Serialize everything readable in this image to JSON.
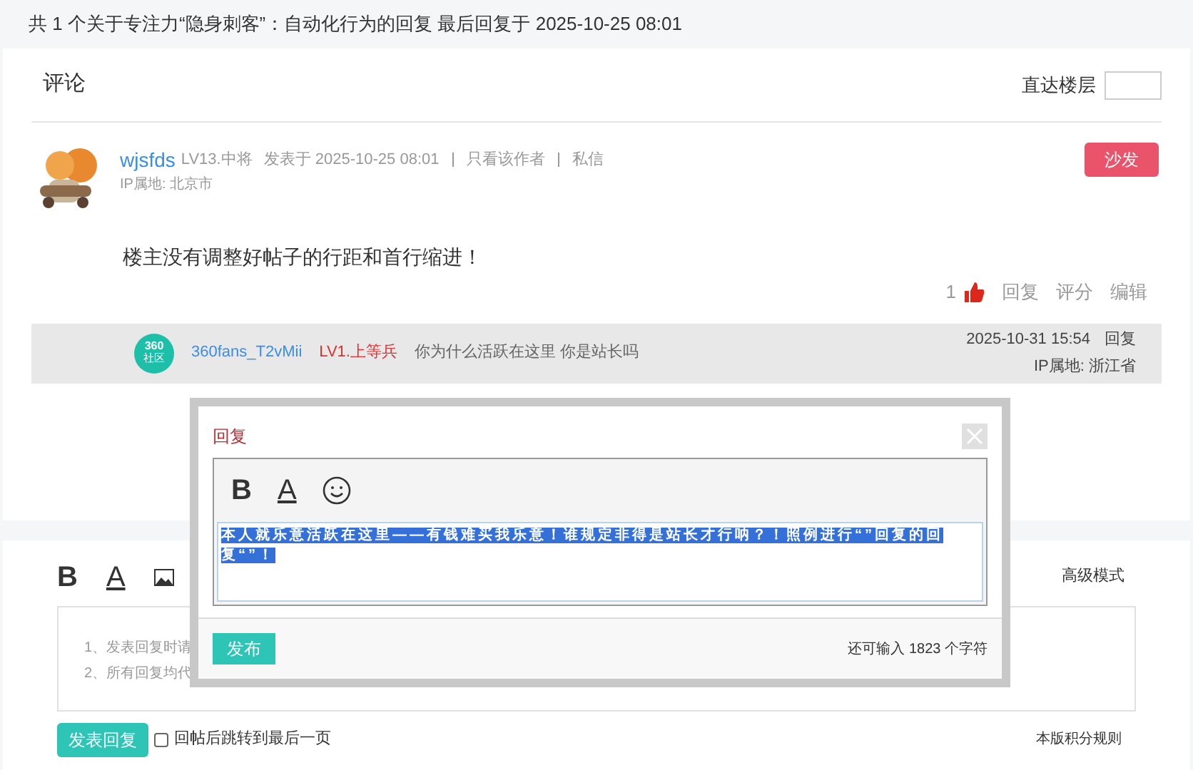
{
  "summary": "共 1 个关于专注力“隐身刺客”：自动化行为的回复 最后回复于 2025-10-25 08:01",
  "section_title": "评论",
  "jump": {
    "label": "直达楼层"
  },
  "post": {
    "author": "wjsfds",
    "level": "LV13.中将",
    "posted": "发表于 2025-10-25 08:01",
    "links": [
      "只看该作者",
      "私信"
    ],
    "ip": "IP属地: 北京市",
    "badge": "沙发",
    "body": "楼主没有调整好帖子的行距和首行缩进！",
    "likes": "1",
    "actions": [
      "回复",
      "评分",
      "编辑"
    ]
  },
  "sub_reply": {
    "logo_text": [
      "360",
      "社区"
    ],
    "author": "360fans_T2vMii",
    "level": "LV1.上等兵",
    "text": "你为什么活跃在这里 你是站长吗",
    "time": "2025-10-31 15:54",
    "reply": "回复",
    "ip": "IP属地: 浙江省"
  },
  "editor": {
    "tools": [
      "B",
      "A"
    ],
    "advanced": "高级模式",
    "hints": [
      "1、发表回复时请",
      "2、所有回复均代"
    ],
    "submit": "发表回复",
    "jump_last": {
      "label": "回帖后跳转到最后一页",
      "checked": false
    },
    "rules": "本版积分规则"
  },
  "dialog": {
    "title": "回复",
    "tools": [
      "B",
      "A"
    ],
    "text": "本人就乐意活跃在这里——有钱难买我乐意！谁规定非得是站长才行呐？！照例进行“”回复的回复“”！",
    "selected": true,
    "publish": "发布",
    "remaining": "还可输入 1823 个字符"
  }
}
